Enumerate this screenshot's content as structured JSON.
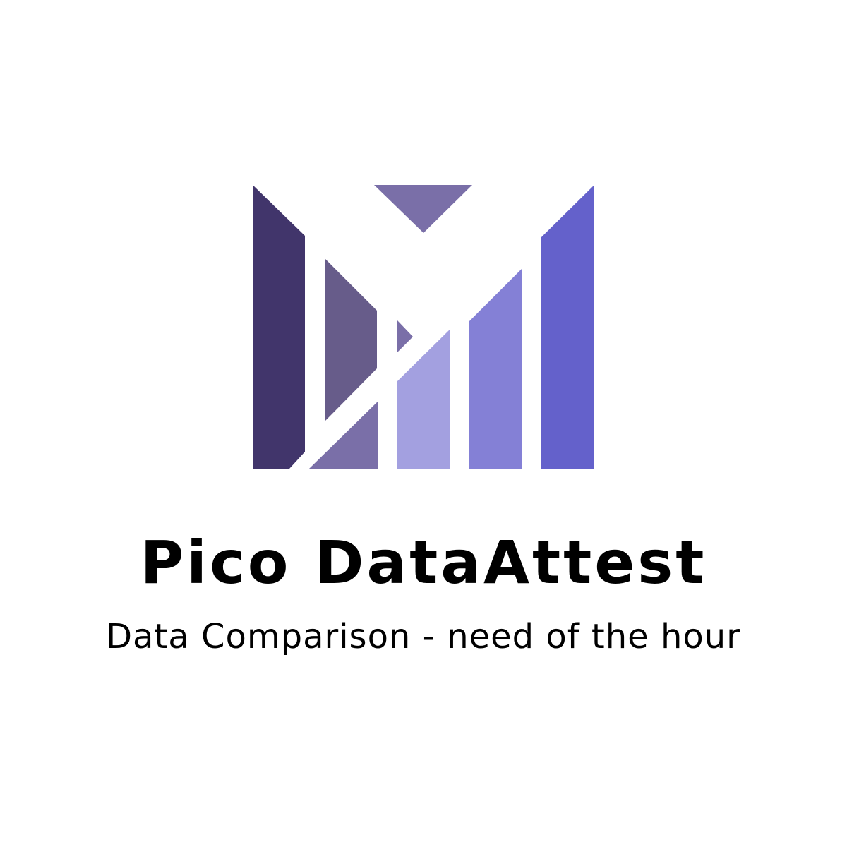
{
  "logo": {
    "icon": "bar-chart-m-icon",
    "colors": {
      "bar_dark": "#41356b",
      "bar_slate": "#675c8a",
      "bar_mid": "#7a6fa8",
      "bar_light": "#a3a0e0",
      "bar_medium": "#8480d6",
      "bar_bright": "#6461cb",
      "background": "#ffffff"
    }
  },
  "brand": {
    "name": "Pico DataAttest",
    "tagline": "Data Comparison - need of the hour"
  }
}
